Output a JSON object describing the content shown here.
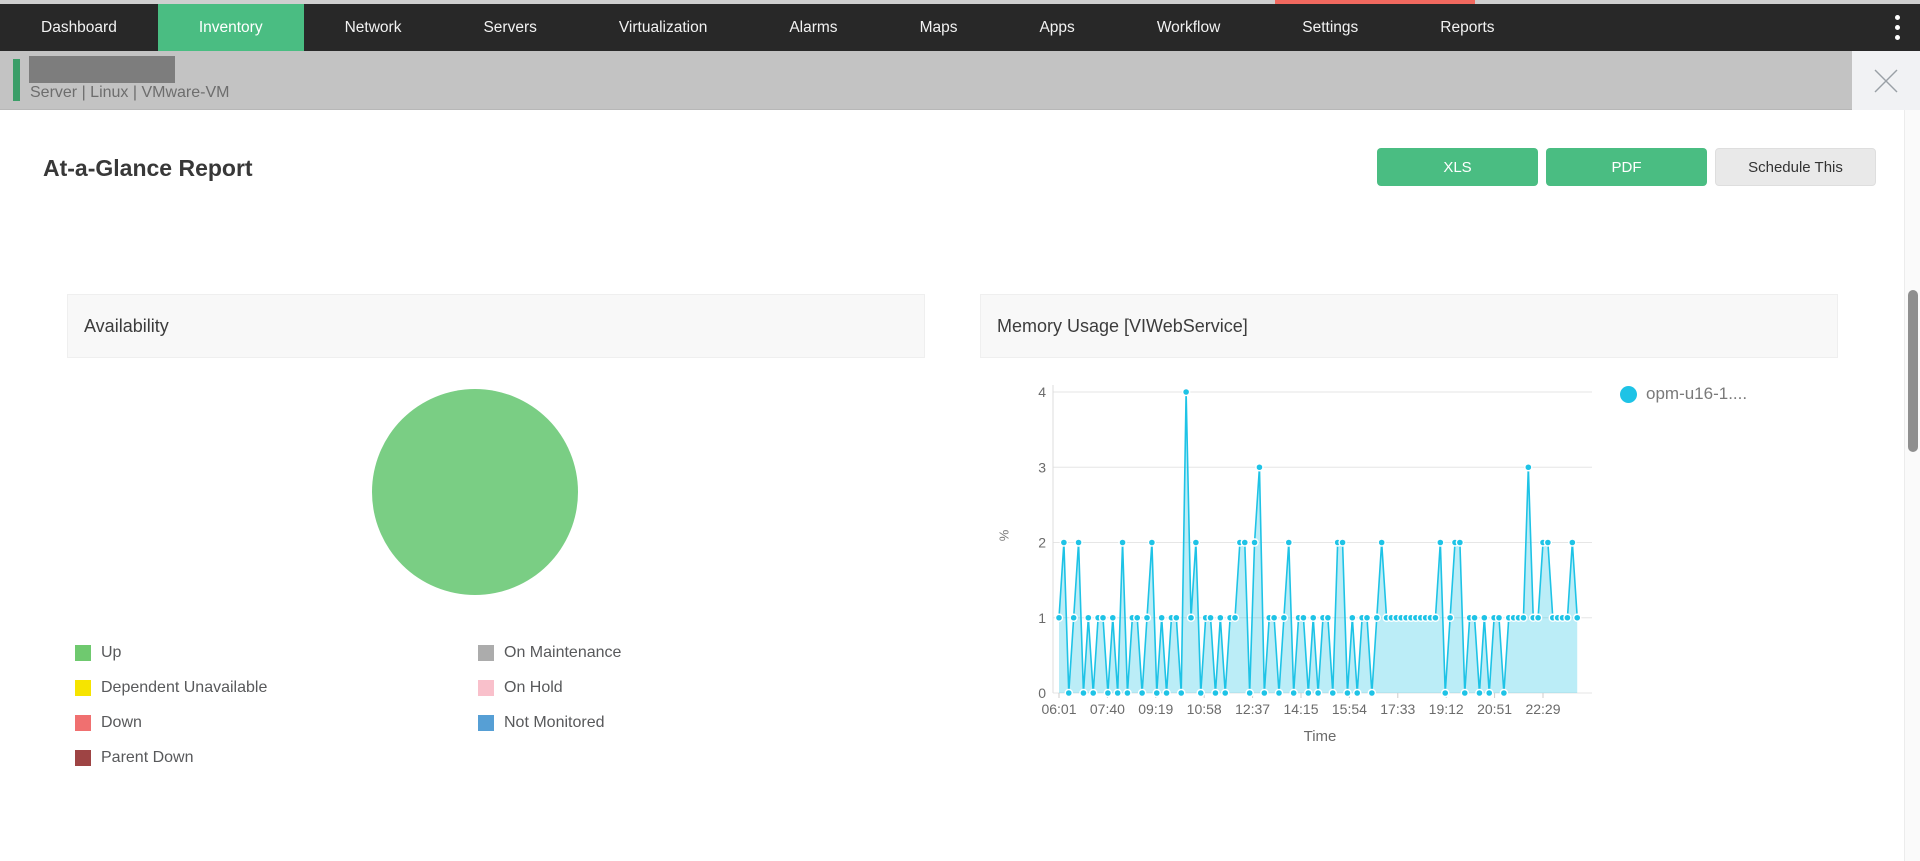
{
  "top_strip": {
    "base_color": "#cfcfcf",
    "highlight_color": "#F2695F"
  },
  "nav": {
    "bg": "#282828",
    "active_bg": "#4ABD82",
    "active_item": "Inventory",
    "items": [
      {
        "label": "Dashboard"
      },
      {
        "label": "Inventory"
      },
      {
        "label": "Network"
      },
      {
        "label": "Servers"
      },
      {
        "label": "Virtualization"
      },
      {
        "label": "Alarms"
      },
      {
        "label": "Maps"
      },
      {
        "label": "Apps"
      },
      {
        "label": "Workflow"
      },
      {
        "label": "Settings"
      },
      {
        "label": "Reports"
      }
    ],
    "overflow_menu": "kebab-vertical"
  },
  "context_bar": {
    "accent_color": "#3B9E68",
    "breadcrumb": "Server | Linux  | VMware-VM",
    "close_label": "✕"
  },
  "report": {
    "title": "At-a-Glance Report",
    "actions": [
      {
        "label": "XLS",
        "style": "primary"
      },
      {
        "label": "PDF",
        "style": "primary"
      },
      {
        "label": "Schedule This",
        "style": "secondary"
      }
    ]
  },
  "panels": {
    "availability": {
      "title": "Availability",
      "legend": [
        {
          "label": "Up",
          "color": "#6FC96F"
        },
        {
          "label": "Dependent Unavailable",
          "color": "#F6E400"
        },
        {
          "label": "Down",
          "color": "#F07070"
        },
        {
          "label": "Parent Down",
          "color": "#9E4444"
        },
        {
          "label": "On Maintenance",
          "color": "#ACACAC"
        },
        {
          "label": "On Hold",
          "color": "#F9C0CB"
        },
        {
          "label": "Not Monitored",
          "color": "#569FD5"
        }
      ]
    },
    "memory": {
      "title": "Memory Usage [VIWebService]",
      "series_name": "opm-u16-1....",
      "series_color": "#1EC3E6",
      "xlabel": "Time",
      "ylabel": "%"
    }
  },
  "chart_data": [
    {
      "type": "pie",
      "title": "Availability",
      "labels": [
        "Up",
        "Dependent Unavailable",
        "Down",
        "Parent Down",
        "On Maintenance",
        "On Hold",
        "Not Monitored"
      ],
      "values": [
        100,
        0,
        0,
        0,
        0,
        0,
        0
      ],
      "colors": [
        "#7ACE84",
        "#F6E400",
        "#F07070",
        "#9E4444",
        "#ACACAC",
        "#F9C0CB",
        "#569FD5"
      ],
      "legend_position": "bottom"
    },
    {
      "type": "area",
      "title": "Memory Usage [VIWebService]",
      "xlabel": "Time",
      "ylabel": "%",
      "ylim": [
        0,
        4
      ],
      "y_ticks": [
        0,
        1,
        2,
        3,
        4
      ],
      "x_tick_labels": [
        "06:01",
        "07:40",
        "09:19",
        "10:58",
        "12:37",
        "14:15",
        "15:54",
        "17:33",
        "19:12",
        "20:51",
        "22:29"
      ],
      "minutes_per_tick": 99,
      "grid": "horizontal",
      "legend_position": "right",
      "series": [
        {
          "name": "opm-u16-1....",
          "color": "#1EC3E6",
          "start": "06:01",
          "step_minutes": 10,
          "values": [
            1,
            2,
            0,
            1,
            2,
            0,
            1,
            0,
            1,
            1,
            0,
            1,
            0,
            2,
            0,
            1,
            1,
            0,
            1,
            2,
            0,
            1,
            0,
            1,
            1,
            0,
            4,
            1,
            2,
            0,
            1,
            1,
            0,
            1,
            0,
            1,
            1,
            2,
            2,
            0,
            2,
            3,
            0,
            1,
            1,
            0,
            1,
            2,
            0,
            1,
            1,
            0,
            1,
            0,
            1,
            1,
            0,
            2,
            2,
            0,
            1,
            0,
            1,
            1,
            0,
            1,
            2,
            1,
            1,
            1,
            1,
            1,
            1,
            1,
            1,
            1,
            1,
            1,
            2,
            0,
            1,
            2,
            2,
            0,
            1,
            1,
            0,
            1,
            0,
            1,
            1,
            0,
            1,
            1,
            1,
            1,
            3,
            1,
            1,
            2,
            2,
            1,
            1,
            1,
            1,
            2,
            1
          ]
        }
      ]
    }
  ]
}
